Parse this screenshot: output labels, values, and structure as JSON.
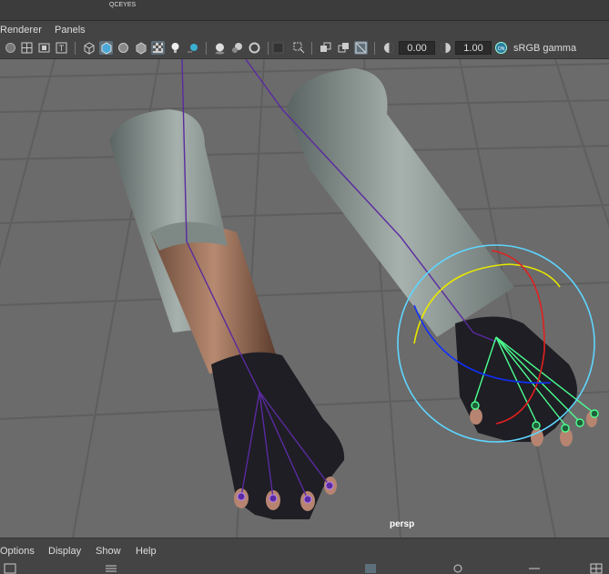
{
  "top_strip": {
    "label": "QCEYES"
  },
  "menu": {
    "renderer": "Renderer",
    "panels": "Panels"
  },
  "toolbar": {
    "icons": [
      "camera-icon",
      "grid-icon",
      "film-gate-icon",
      "text-icon",
      "wireframe-icon",
      "smooth-shade-icon",
      "wireframe-on-shaded-icon",
      "default-material-icon",
      "textured-icon",
      "lights-icon",
      "shadows-icon",
      "ambient-occlusion-icon",
      "motion-blur-icon",
      "antialias-icon",
      "isolate-select-icon",
      "xray-icon",
      "xray-joints-icon",
      "backface-icon",
      "exposure-icon",
      "gamma-icon",
      "color-management-icon"
    ],
    "exposure_value": "0.00",
    "gamma_value": "1.00",
    "color_space": "sRGB gamma"
  },
  "viewport": {
    "camera_label": "persp"
  },
  "bottom_menu": {
    "options": "Options",
    "display": "Display",
    "show": "Show",
    "help": "Help"
  },
  "colors": {
    "grid": "#5f5f5f",
    "viewport_bg": "#6b6b6b",
    "joint": "#5a2aa0",
    "selected_joint": "#4cff90",
    "manip_outer": "#5fd6ff",
    "manip_x": "#e02020",
    "manip_y": "#e8e800",
    "manip_z": "#1030ff"
  }
}
